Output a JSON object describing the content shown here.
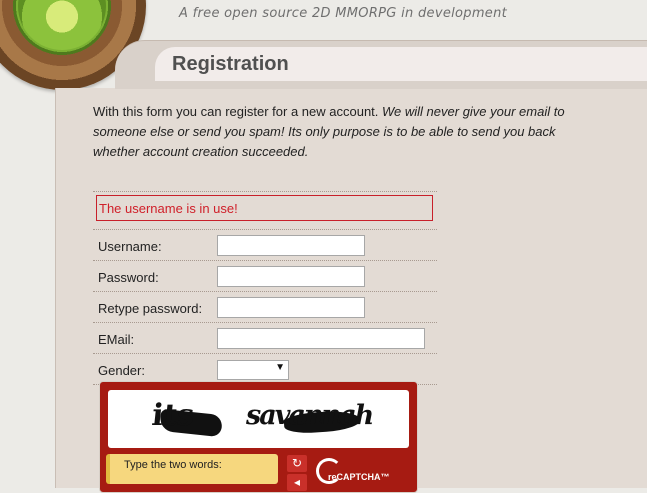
{
  "header": {
    "tagline": "A free open source 2D MMORPG in development"
  },
  "page": {
    "title": "Registration",
    "intro_plain": "With this form you can register for a new account. ",
    "intro_italic": "We will never give your email to someone else or send you spam! Its only purpose is to be able to send you back whether account creation succeeded."
  },
  "form": {
    "error": "The username is in use!",
    "username_label": "Username:",
    "password_label": "Password:",
    "retype_label": "Retype password:",
    "email_label": "EMail:",
    "gender_label": "Gender:",
    "username_value": "",
    "password_value": "",
    "retype_value": "",
    "email_value": "",
    "gender_value": ""
  },
  "captcha": {
    "word1": "its",
    "word2": "savannah",
    "prompt": "Type the two words:",
    "reload_icon": "reload-icon",
    "audio_icon": "audio-icon",
    "brand": "reCAPTCHA™",
    "accent": "#a61b12"
  }
}
